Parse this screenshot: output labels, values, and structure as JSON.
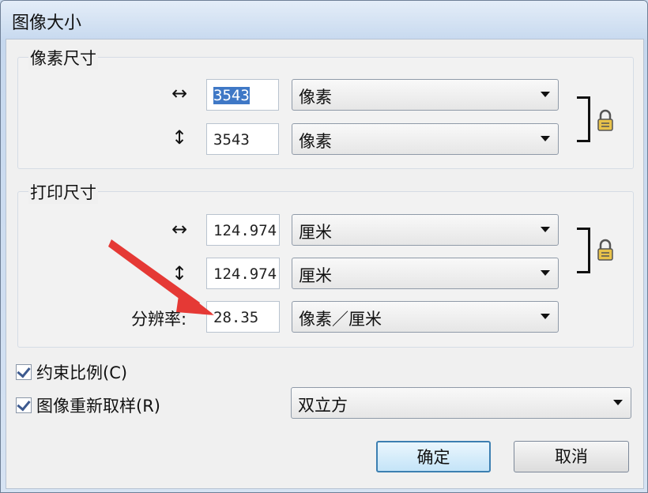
{
  "window": {
    "title": "图像大小"
  },
  "pixel_dimensions": {
    "label": "像素尺寸",
    "width_value": "3543",
    "width_unit": "像素",
    "height_value": "3543",
    "height_unit": "像素",
    "horizontal_glyph": "↔",
    "vertical_glyph": "↕"
  },
  "print_size": {
    "label": "打印尺寸",
    "width_value": "124.974",
    "width_unit": "厘米",
    "height_value": "124.974",
    "height_unit": "厘米",
    "resolution_label": "分辨率:",
    "resolution_value": "28.35",
    "resolution_unit": "像素／厘米",
    "horizontal_glyph": "↔",
    "vertical_glyph": "↕"
  },
  "options": {
    "constrain_label": "约束比例(C)",
    "constrain_checked": true,
    "resample_label": "图像重新取样(R)",
    "resample_checked": true,
    "resample_method": "双立方"
  },
  "buttons": {
    "ok": "确定",
    "cancel": "取消"
  },
  "colors": {
    "annotation_arrow": "#e53935",
    "selection": "#3f78c6"
  }
}
